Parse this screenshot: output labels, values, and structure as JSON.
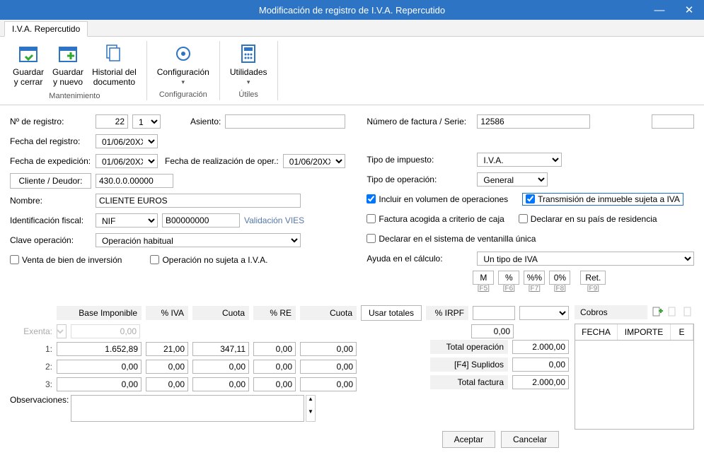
{
  "window": {
    "title": "Modificación de registro de I.V.A. Repercutido"
  },
  "tab": {
    "label": "I.V.A. Repercutido"
  },
  "ribbon": {
    "save_close": "Guardar\ny cerrar",
    "save_new": "Guardar\ny nuevo",
    "historial": "Historial del\ndocumento",
    "config": "Configuración",
    "util": "Utilidades",
    "group_mant": "Mantenimiento",
    "group_config": "Configuración",
    "group_util": "Útiles"
  },
  "form": {
    "nregistro_lab": "Nº de registro:",
    "nregistro": "22",
    "nregistro_sub": "1",
    "asiento_lab": "Asiento:",
    "asiento": "",
    "fecha_reg_lab": "Fecha del registro:",
    "fecha_reg": "01/06/20XX",
    "fecha_exp_lab": "Fecha de expedición:",
    "fecha_exp": "01/06/20XX",
    "fecha_oper_lab": "Fecha de realización de oper.:",
    "fecha_oper": "01/06/20XX",
    "cliente_btn": "Cliente / Deudor:",
    "cliente": "430.0.0.00000",
    "nombre_lab": "Nombre:",
    "nombre": "CLIENTE EUROS",
    "id_fiscal_lab": "Identificación fiscal:",
    "id_fiscal_tipo": "NIF",
    "id_fiscal_num": "B00000000",
    "vies": "Validación VIES",
    "clave_lab": "Clave operación:",
    "clave": "Operación habitual",
    "venta_bien": "Venta de bien de inversión",
    "op_no_sujeta": "Operación no sujeta a I.V.A.",
    "num_fact_lab": "Número de factura / Serie:",
    "num_fact": "12586",
    "serie": "",
    "tipo_imp_lab": "Tipo de impuesto:",
    "tipo_imp": "I.V.A.",
    "tipo_op_lab": "Tipo de operación:",
    "tipo_op": "General",
    "incluir_vol": "Incluir en volumen de operaciones",
    "transm": "Transmisión de inmueble sujeta a IVA",
    "criterio_caja": "Factura acogida a criterio de caja",
    "declarar_pais": "Declarar en su país de residencia",
    "ventanilla": "Declarar en el sistema de ventanilla única",
    "ayuda_lab": "Ayuda en el cálculo:",
    "ayuda": "Un tipo de IVA",
    "btn_m": "M",
    "btn_pct": "%",
    "btn_pctpct": "%%",
    "btn_0pct": "0%",
    "btn_ret": "Ret.",
    "f5": "[F5]",
    "f6": "[F6]",
    "f7": "[F7]",
    "f8": "[F8]",
    "f9": "[F9]"
  },
  "grid": {
    "head": {
      "base": "Base Imponible",
      "iva": "% IVA",
      "cuota": "Cuota",
      "re": "% RE",
      "cuota2": "Cuota",
      "usar": "Usar totales",
      "irpf": "% IRPF"
    },
    "exenta_lab": "Exenta:",
    "exenta_base": "0,00",
    "rows": [
      {
        "lab": "1:",
        "base": "1.652,89",
        "iva": "21,00",
        "cuota": "347,11",
        "re": "0,00",
        "cuota2": "0,00"
      },
      {
        "lab": "2:",
        "base": "0,00",
        "iva": "0,00",
        "cuota": "0,00",
        "re": "0,00",
        "cuota2": "0,00"
      },
      {
        "lab": "3:",
        "base": "0,00",
        "iva": "0,00",
        "cuota": "0,00",
        "re": "0,00",
        "cuota2": "0,00"
      }
    ],
    "irpf_val": "",
    "irpf_amount": "0,00",
    "total_op_lab": "Total operación",
    "total_op": "2.000,00",
    "suplidos_lab": "[F4] Suplidos",
    "suplidos": "0,00",
    "total_fact_lab": "Total factura",
    "total_fact": "2.000,00",
    "obs_lab": "Observaciones:",
    "obs": ""
  },
  "cobros": {
    "title": "Cobros",
    "th_fecha": "FECHA",
    "th_importe": "IMPORTE",
    "th_e": "E"
  },
  "dialog": {
    "aceptar": "Aceptar",
    "cancelar": "Cancelar"
  }
}
